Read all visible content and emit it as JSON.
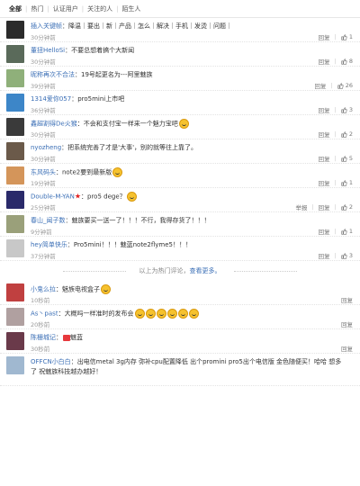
{
  "tabs": [
    "全部",
    "热门",
    "认证用户",
    "关注的人",
    "陌生人"
  ],
  "comments": [
    {
      "user": "插入关键帧",
      "sep": "：",
      "text": "降温｜要出｜新｜产品｜怎么｜解决｜手机｜发烫｜问题｜",
      "time": "30分钟前",
      "reply": "回复",
      "likes": "1",
      "emoji": 0
    },
    {
      "user": "董扭HelloSi",
      "sep": "：",
      "text": "不要总想着搞个大新闻",
      "time": "30分钟前",
      "reply": "回复",
      "likes": "8",
      "emoji": 0
    },
    {
      "user": "昵称再次不合法",
      "sep": "：",
      "text": "19号起更名为---阿里魅族",
      "time": "39分钟前",
      "reply": "回复",
      "likes": "26",
      "emoji": 0
    },
    {
      "user": "1314爱你057",
      "sep": "：",
      "text": "pro5mini上市吧",
      "time": "36分钟前",
      "reply": "回复",
      "likes": "3",
      "emoji": 0
    },
    {
      "user": "鑫超割得De火猴",
      "sep": "：",
      "text": "不会和支付宝一样来一个魅力宝吧",
      "time": "30分钟前",
      "reply": "回复",
      "likes": "2",
      "emoji": 1
    },
    {
      "user": "nyozheng",
      "sep": "：",
      "text": "把系统完善了才是'大事'，别的就等往上靠了。",
      "time": "30分钟前",
      "reply": "回复",
      "likes": "5",
      "emoji": 0
    },
    {
      "user": "东风码头",
      "sep": "：",
      "text": "note2要到最新版",
      "time": "19分钟前",
      "reply": "回复",
      "likes": "1",
      "emoji": 1
    },
    {
      "user": "Double-M-YAN",
      "sep": "：",
      "text": "pro5 dege？",
      "time": "25分钟前",
      "reply": "回复",
      "report": "举报",
      "likes": "2",
      "emoji": 1,
      "star": "★"
    },
    {
      "user": "春山_闻子数",
      "sep": "：",
      "text": "魅族要买一送一了！！！不行，我得存货了！！！",
      "time": "9分钟前",
      "reply": "回复",
      "likes": "1",
      "emoji": 0
    },
    {
      "user": "hey简单快乐",
      "sep": "：",
      "text": "Pro5mini！！！魅蓝note2flyme5！！！",
      "time": "37分钟前",
      "reply": "回复",
      "likes": "3",
      "emoji": 0
    }
  ],
  "divider": {
    "text": "以上为热门评论，",
    "more": "查看更多。"
  },
  "recent": [
    {
      "user": "小鬼么拉",
      "sep": "：",
      "text": "魅族电视盒子",
      "time": "10秒前",
      "reply": "回复",
      "emoji": 1
    },
    {
      "user": "As丶past",
      "sep": "：",
      "text": "大概吗一样准时的发布会",
      "time": "20秒前",
      "reply": "回复",
      "emoji": 6
    },
    {
      "user": "陈栅城记",
      "sep": "：",
      "text": "魅蓝",
      "time": "30秒前",
      "reply": "回复",
      "emoji": 0,
      "badge": true
    },
    {
      "user": "OFFCN小白白",
      "sep": "：",
      "text": "出电信metal 3g内存 弥补cpu配置降低 出个promini pro5出个电信版 金色随便买！哈哈 想多了 祝魅族科技越办越好！",
      "time": "",
      "reply": "",
      "emoji": 0
    }
  ],
  "colors": {
    "link": "#3b6fb6",
    "time": "#999999"
  }
}
